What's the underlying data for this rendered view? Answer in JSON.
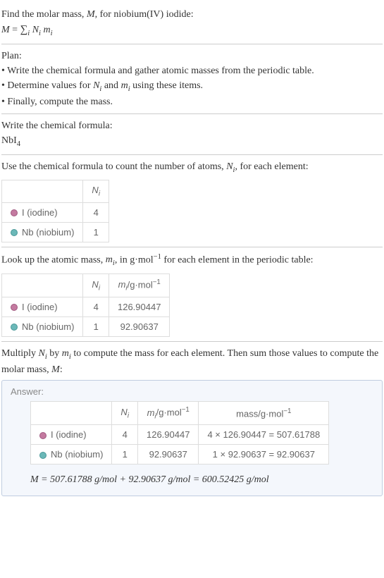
{
  "intro": {
    "line1": "Find the molar mass, M, for niobium(IV) iodide:",
    "formula": "M = ∑",
    "formula_sub": "i",
    "formula_rest": " Nᵢ mᵢ"
  },
  "plan": {
    "heading": "Plan:",
    "bullets": [
      "• Write the chemical formula and gather atomic masses from the periodic table.",
      "• Determine values for Nᵢ and mᵢ using these items.",
      "• Finally, compute the mass."
    ]
  },
  "formula_section": {
    "heading": "Write the chemical formula:",
    "formula_main": "NbI",
    "formula_sub": "4"
  },
  "count_section": {
    "heading": "Use the chemical formula to count the number of atoms, Nᵢ, for each element:",
    "headers": [
      "",
      "Nᵢ"
    ],
    "rows": [
      {
        "label": "I (iodine)",
        "dot": "dot-i",
        "n": "4"
      },
      {
        "label": "Nb (niobium)",
        "dot": "dot-nb",
        "n": "1"
      }
    ]
  },
  "mass_section": {
    "heading_a": "Look up the atomic mass, mᵢ, in g·mol",
    "heading_exp": "−1",
    "heading_b": " for each element in the periodic table:",
    "headers": [
      "",
      "Nᵢ",
      "mᵢ/g·mol⁻¹"
    ],
    "rows": [
      {
        "label": "I (iodine)",
        "dot": "dot-i",
        "n": "4",
        "m": "126.90447"
      },
      {
        "label": "Nb (niobium)",
        "dot": "dot-nb",
        "n": "1",
        "m": "92.90637"
      }
    ]
  },
  "multiply_section": {
    "heading": "Multiply Nᵢ by mᵢ to compute the mass for each element. Then sum those values to compute the molar mass, M:"
  },
  "answer": {
    "label": "Answer:",
    "headers": [
      "",
      "Nᵢ",
      "mᵢ/g·mol⁻¹",
      "mass/g·mol⁻¹"
    ],
    "rows": [
      {
        "label": "I (iodine)",
        "dot": "dot-i",
        "n": "4",
        "m": "126.90447",
        "mass": "4 × 126.90447 = 507.61788"
      },
      {
        "label": "Nb (niobium)",
        "dot": "dot-nb",
        "n": "1",
        "m": "92.90637",
        "mass": "1 × 92.90637 = 92.90637"
      }
    ],
    "final": "M = 507.61788 g/mol + 92.90637 g/mol = 600.52425 g/mol"
  }
}
